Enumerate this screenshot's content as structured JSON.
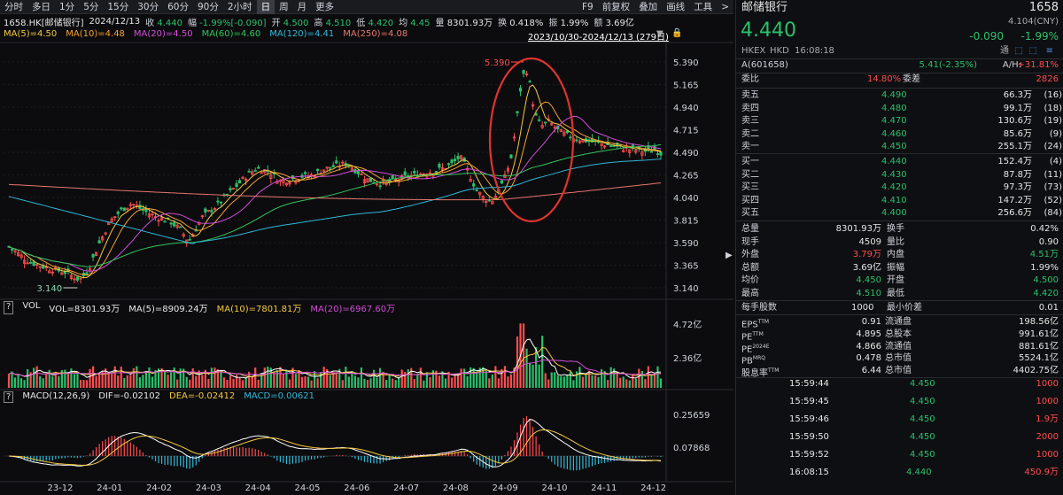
{
  "toolbar": {
    "items": [
      "分时",
      "多日",
      "1分",
      "5分",
      "15分",
      "30分",
      "60分",
      "90分",
      "2小时",
      "日",
      "周",
      "月",
      "更多"
    ],
    "active_index": 9,
    "right_items": [
      "F9",
      "前复权",
      "叠加",
      "画线",
      "工具",
      ">"
    ]
  },
  "infobar": {
    "code": "1658.HK[邮储银行]",
    "date": "2024/12/13",
    "close_label": "收",
    "close": "4.440",
    "chg_label": "幅",
    "chg": "-1.99%[-0.090]",
    "open_label": "开",
    "open": "4.500",
    "high_label": "高",
    "high": "4.510",
    "low_label": "低",
    "low": "4.420",
    "avg_label": "均",
    "avg": "4.45",
    "vol_label": "量",
    "vol": "8301.93万",
    "turn_label": "换",
    "turn": "0.418%",
    "amp_label": "振",
    "amp": "1.99%",
    "amt_label": "额",
    "amt": "3.69亿"
  },
  "ma_line": [
    "MA(5)=4.50",
    "MA(10)=4.48",
    "MA(20)=4.50",
    "MA(60)=4.60",
    "MA(120)=4.41",
    "MA(250)=4.08"
  ],
  "range": "2023/10/30-2024/12/13 (279日)",
  "vol_line": {
    "label": "VOL",
    "vol": "VOL=8301.93万",
    "ma5": "MA(5)=8909.24万",
    "ma10": "MA(10)=7801.81万",
    "ma20": "MA(20)=6967.60万"
  },
  "macd_line": {
    "label": "MACD(12,26,9)",
    "dif": "DIF=-0.02102",
    "dea": "DEA=-0.02412",
    "macd": "MACD=0.00621"
  },
  "chart_data": {
    "type": "candlestick",
    "price_axis": [
      "5.390",
      "5.165",
      "4.940",
      "4.715",
      "4.490",
      "4.265",
      "4.040",
      "3.815",
      "3.590",
      "3.365",
      "3.140"
    ],
    "ylim": [
      3.14,
      5.39
    ],
    "x_ticks": [
      "23-12",
      "24-01",
      "24-02",
      "24-03",
      "24-04",
      "24-05",
      "24-06",
      "24-07",
      "24-08",
      "24-09",
      "24-10",
      "24-11",
      "24-12"
    ],
    "annotations": {
      "max": "5.390",
      "min": "3.140"
    },
    "volume_axis": [
      "4.72亿",
      "2.36亿"
    ],
    "macd_axis": [
      "0.25659",
      "0.07868"
    ],
    "colors": {
      "up": "#ff4d4f",
      "down": "#2bc06b",
      "ma5": "#f5c842",
      "ma10": "#f7a035",
      "ma20": "#d24dd9",
      "ma60": "#33c45d",
      "ma120": "#30b8d8",
      "ma250": "#e8776d"
    }
  },
  "quote": {
    "name": "邮储银行",
    "code": "1658",
    "price": "4.440",
    "ref": "4.104(CNY)",
    "change": "-0.090",
    "change_pct": "-1.99%",
    "exchange": "HKEX",
    "currency": "HKD",
    "time": "16:08:18",
    "tong": "通",
    "a_code": "A(601658)",
    "a_price": "5.41(-2.35%)",
    "ah_label": "A/H:",
    "ah": "+31.81%",
    "wb_label": "委比",
    "wb": "14.80%",
    "wc_label": "委差",
    "wc": "2826"
  },
  "asks": [
    {
      "label": "卖五",
      "price": "4.490",
      "vol": "66.3万",
      "n": "(16)"
    },
    {
      "label": "卖四",
      "price": "4.480",
      "vol": "99.1万",
      "n": "(18)"
    },
    {
      "label": "卖三",
      "price": "4.470",
      "vol": "130.6万",
      "n": "(19)"
    },
    {
      "label": "卖二",
      "price": "4.460",
      "vol": "85.6万",
      "n": "(9)"
    },
    {
      "label": "卖一",
      "price": "4.450",
      "vol": "255.1万",
      "n": "(24)"
    }
  ],
  "bids": [
    {
      "label": "买一",
      "price": "4.440",
      "vol": "152.4万",
      "n": "(4)"
    },
    {
      "label": "买二",
      "price": "4.430",
      "vol": "87.8万",
      "n": "(11)"
    },
    {
      "label": "买三",
      "price": "4.420",
      "vol": "97.3万",
      "n": "(73)"
    },
    {
      "label": "买四",
      "price": "4.410",
      "vol": "147.2万",
      "n": "(52)"
    },
    {
      "label": "买五",
      "price": "4.400",
      "vol": "256.6万",
      "n": "(84)"
    }
  ],
  "stats": [
    {
      "l1": "总量",
      "v1": "8301.93万",
      "c1": "white",
      "l2": "换手",
      "v2": "0.42%",
      "c2": "white"
    },
    {
      "l1": "现手",
      "v1": "4509",
      "c1": "white",
      "l2": "量比",
      "v2": "0.90",
      "c2": "white"
    },
    {
      "l1": "外盘",
      "v1": "3.79万",
      "c1": "up",
      "l2": "内盘",
      "v2": "4.51万",
      "c2": "down"
    },
    {
      "l1": "总额",
      "v1": "3.69亿",
      "c1": "white",
      "l2": "振幅",
      "v2": "1.99%",
      "c2": "white"
    },
    {
      "l1": "均价",
      "v1": "4.450",
      "c1": "down",
      "l2": "开盘",
      "v2": "4.500",
      "c2": "down"
    },
    {
      "l1": "最高",
      "v1": "4.510",
      "c1": "down",
      "l2": "最低",
      "v2": "4.420",
      "c2": "down"
    }
  ],
  "lot": {
    "l1": "每手股数",
    "v1": "1000",
    "l2": "最小价差",
    "v2": "0.01"
  },
  "fund": [
    {
      "l1": "EPS",
      "sup1": "TTM",
      "v1": "0.91",
      "l2": "流通盘",
      "v2": "198.56亿"
    },
    {
      "l1": "PE",
      "sup1": "TTM",
      "v1": "4.895",
      "l2": "总股本",
      "v2": "991.61亿"
    },
    {
      "l1": "PE",
      "sup1": "2024E",
      "v1": "4.866",
      "l2": "流通值",
      "v2": "881.61亿"
    },
    {
      "l1": "PB",
      "sup1": "MRQ",
      "v1": "0.478",
      "l2": "总市值",
      "v2": "5524.1亿"
    },
    {
      "l1": "股息率",
      "sup1": "TTM",
      "v1": "6.44",
      "l2": "总市值",
      "v2": "4402.75亿"
    }
  ],
  "ticks": [
    {
      "t": "15:59:44",
      "p": "4.450",
      "v": "1000"
    },
    {
      "t": "15:59:45",
      "p": "4.450",
      "v": "1000"
    },
    {
      "t": "15:59:46",
      "p": "4.450",
      "v": "1.9万"
    },
    {
      "t": "15:59:50",
      "p": "4.450",
      "v": "2000"
    },
    {
      "t": "15:59:52",
      "p": "4.450",
      "v": "1000"
    },
    {
      "t": "16:08:15",
      "p": "4.440",
      "v": "450.9万"
    }
  ]
}
